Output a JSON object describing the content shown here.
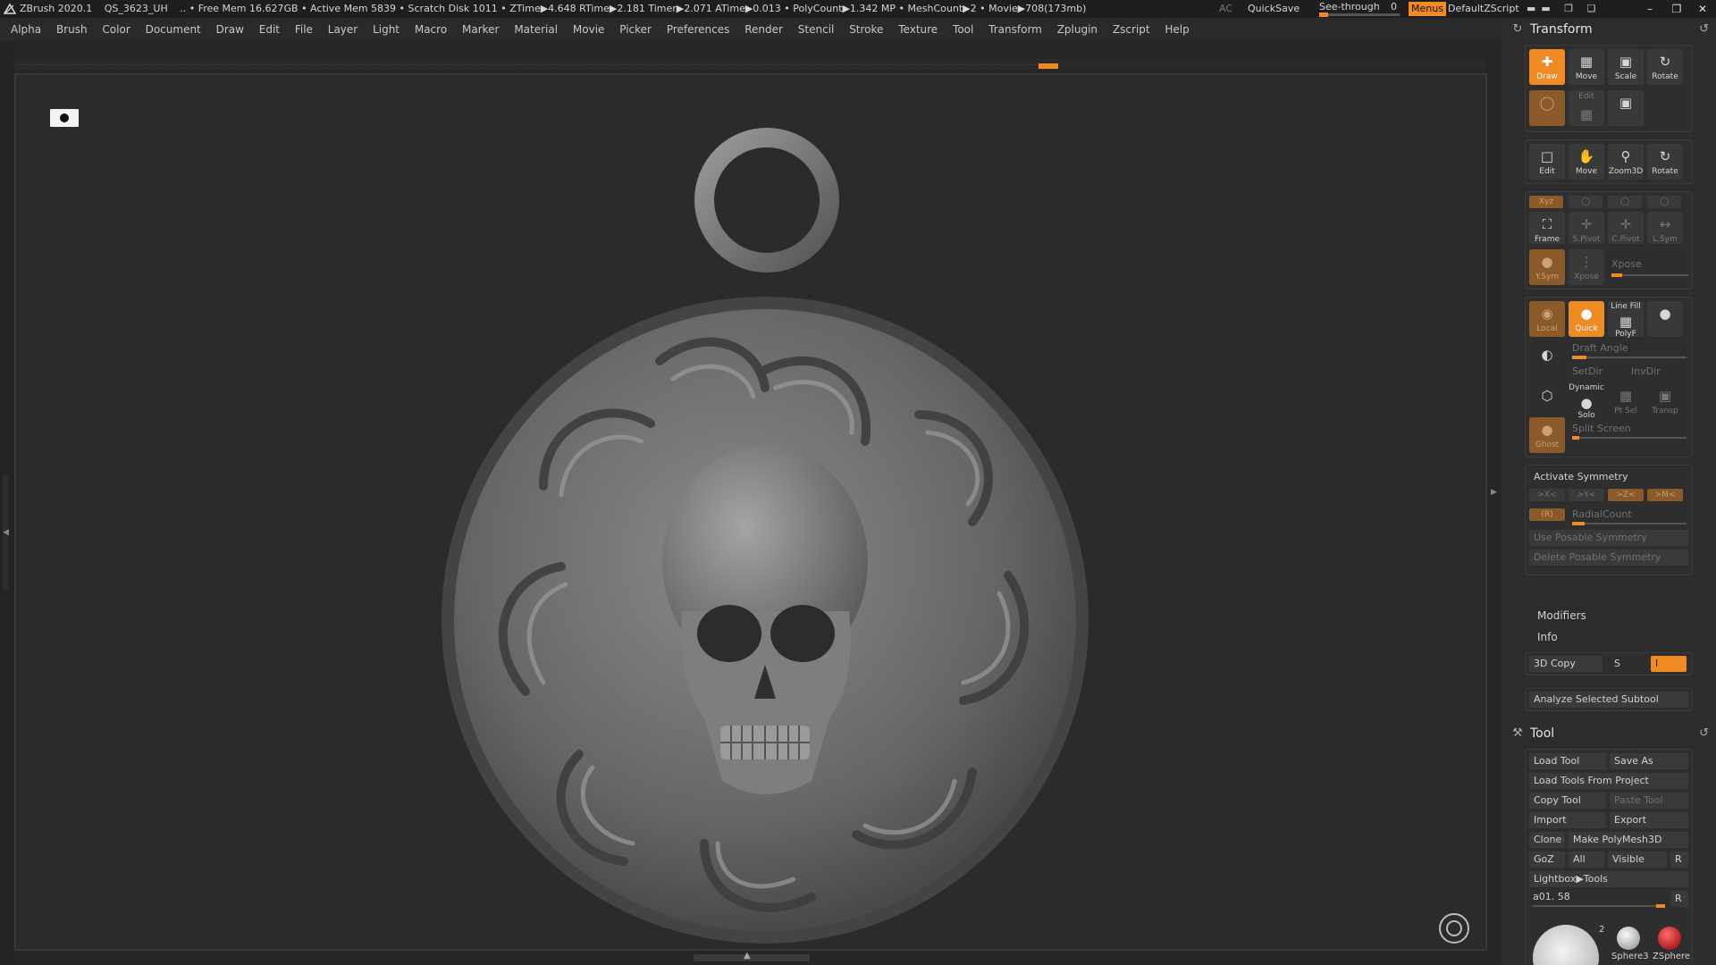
{
  "titlebar": {
    "stats": [
      "ZBrush 2020.1",
      "QS_3623_UH",
      ".. • Free Mem 16.627GB • Active Mem 5839 • Scratch Disk 1011 • ZTime▶4.648 RTime▶2.181 Timer▶2.071 ATime▶0.013 • PolyCount▶1.342 MP • MeshCount▶2 • Movie▶708(173mb)"
    ],
    "ac": "AC",
    "quicksave": "QuickSave",
    "seethrough_label": "See-through",
    "seethrough_value": "0",
    "seethrough_level": 0,
    "menus": "Menus",
    "default_zscript": "DefaultZScript"
  },
  "menubar": [
    "Alpha",
    "Brush",
    "Color",
    "Document",
    "Draw",
    "Edit",
    "File",
    "Layer",
    "Light",
    "Macro",
    "Marker",
    "Material",
    "Movie",
    "Picker",
    "Preferences",
    "Render",
    "Stencil",
    "Stroke",
    "Texture",
    "Tool",
    "Transform",
    "Zplugin",
    "Zscript",
    "Help"
  ],
  "transform": {
    "title": "Transform",
    "draw_buttons": [
      {
        "label": "Draw",
        "icon": "draw-icon"
      },
      {
        "label": "Move",
        "icon": "move-icon"
      },
      {
        "label": "Scale",
        "icon": "scale-icon"
      },
      {
        "label": "Rotate",
        "icon": "rotate-icon"
      }
    ],
    "edit_label": "Edit",
    "nav_buttons": [
      {
        "label": "Edit"
      },
      {
        "label": "Move"
      },
      {
        "label": "Zoom3D"
      },
      {
        "label": "Rotate"
      }
    ],
    "axis_buttons": [
      {
        "label": "Frame"
      },
      {
        "label": "S.Pivot"
      },
      {
        "label": "C.Pivot"
      },
      {
        "label": "L.Sym"
      }
    ],
    "xyz": "Xyz",
    "xpose": "Xpose",
    "ysym": "Y.Sym",
    "xpose_btn": "Xpose",
    "local": "Local",
    "quick": "Quick",
    "linefill": "Line Fill",
    "polyf": "PolyF",
    "draft_angle": "Draft Angle",
    "setdir": "SetDir",
    "invdir": "InvDir",
    "dynamic": "Dynamic",
    "solo": "Solo",
    "ptsel": "Pt Sel",
    "transp": "Transp",
    "ghost": "Ghost",
    "split_screen": "Split Screen",
    "activate_symmetry": "Activate Symmetry",
    "sym_axes": [
      ">X<",
      ">Y<",
      ">Z<",
      ">M<"
    ],
    "r_label": "(R)",
    "radial_count": "RadialCount",
    "use_posable": "Use Posable Symmetry",
    "delete_posable": "Delete Posable Symmetry",
    "modifiers": "Modifiers",
    "info": "Info",
    "copy3d": "3D Copy",
    "s_label": "S",
    "i_label": "I",
    "analyze": "Analyze Selected Subtool"
  },
  "tool": {
    "title": "Tool",
    "load_tool": "Load Tool",
    "save_as": "Save As",
    "load_from_project": "Load Tools From Project",
    "copy_tool": "Copy Tool",
    "paste_tool": "Paste Tool",
    "import": "Import",
    "export": "Export",
    "clone": "Clone",
    "make_polymesh": "Make PolyMesh3D",
    "goz": "GoZ",
    "all": "All",
    "visible": "Visible",
    "r": "R",
    "lightbox_tools": "Lightbox▶Tools",
    "current_tool": "a01. 58",
    "current_r": "R",
    "thumb_count": "2",
    "thumbs": [
      "Sphere3",
      "ZSphere"
    ]
  },
  "colors": {
    "accent": "#f08a24",
    "bg": "#262626",
    "panel": "#2c2c2c"
  }
}
